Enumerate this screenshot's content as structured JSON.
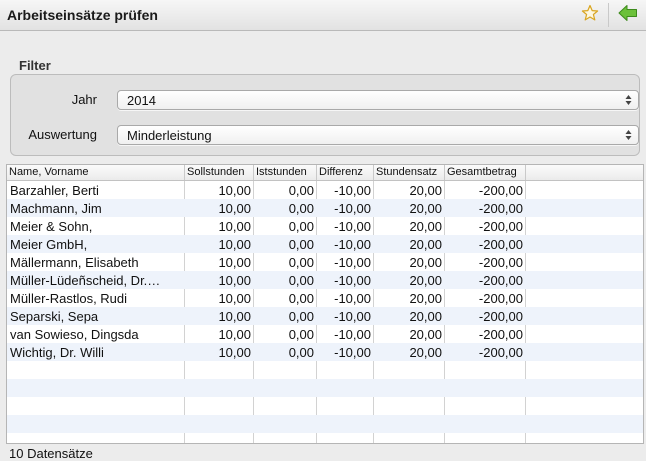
{
  "window": {
    "title": "Arbeitseinsätze prüfen",
    "favorite_icon": "star-icon",
    "back_icon": "green-arrow-left-icon"
  },
  "filter": {
    "heading": "Filter",
    "jahr_label": "Jahr",
    "jahr_value": "2014",
    "auswertung_label": "Auswertung",
    "auswertung_value": "Minderleistung"
  },
  "table": {
    "columns": [
      "Name, Vorname",
      "Sollstunden",
      "Iststunden",
      "Differenz",
      "Stundensatz",
      "Gesamtbetrag"
    ],
    "rows": [
      [
        "Barzahler, Berti",
        "10,00",
        "0,00",
        "-10,00",
        "20,00",
        "-200,00"
      ],
      [
        "Machmann, Jim",
        "10,00",
        "0,00",
        "-10,00",
        "20,00",
        "-200,00"
      ],
      [
        "Meier & Sohn,",
        "10,00",
        "0,00",
        "-10,00",
        "20,00",
        "-200,00"
      ],
      [
        "Meier GmbH,",
        "10,00",
        "0,00",
        "-10,00",
        "20,00",
        "-200,00"
      ],
      [
        "Mällermann, Elisabeth",
        "10,00",
        "0,00",
        "-10,00",
        "20,00",
        "-200,00"
      ],
      [
        "Müller-Lüdeñscheid, Dr.…",
        "10,00",
        "0,00",
        "-10,00",
        "20,00",
        "-200,00"
      ],
      [
        "Müller-Rastlos, Rudi",
        "10,00",
        "0,00",
        "-10,00",
        "20,00",
        "-200,00"
      ],
      [
        "Separski, Sepa",
        "10,00",
        "0,00",
        "-10,00",
        "20,00",
        "-200,00"
      ],
      [
        "van Sowieso, Dingsda",
        "10,00",
        "0,00",
        "-10,00",
        "20,00",
        "-200,00"
      ],
      [
        "Wichtig, Dr. Willi",
        "10,00",
        "0,00",
        "-10,00",
        "20,00",
        "-200,00"
      ]
    ]
  },
  "status": {
    "count_text": "10 Datensätze"
  },
  "colors": {
    "alt_row": "#eef3fb",
    "back_arrow": "#5cb030",
    "star": "#e0b020"
  }
}
